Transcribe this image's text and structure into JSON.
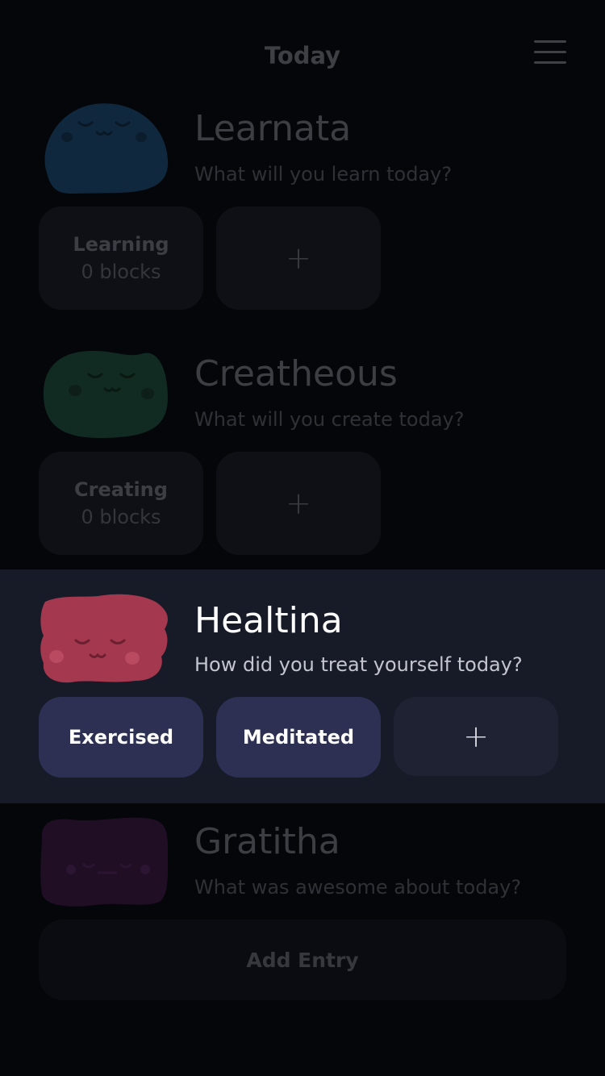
{
  "header": {
    "title": "Today",
    "menu_icon": "hamburger-menu-icon"
  },
  "sections": [
    {
      "name": "Learnata",
      "prompt": "What will you learn today?",
      "color": "#10283e",
      "chips": [
        {
          "label": "Learning",
          "count": "0 blocks"
        }
      ],
      "add_label": "+"
    },
    {
      "name": "Creatheous",
      "prompt": "What will you create today?",
      "color": "#122b22",
      "chips": [
        {
          "label": "Creating",
          "count": "0 blocks"
        }
      ],
      "add_label": "+"
    },
    {
      "name": "Healtina",
      "prompt": "How did you treat yourself today?",
      "color": "#a3384f",
      "chips": [
        {
          "label": "Exercised"
        },
        {
          "label": "Meditated"
        }
      ],
      "add_label": "+"
    },
    {
      "name": "Gratitha",
      "prompt": "What was awesome about today?",
      "color": "#200e25",
      "add_entry_label": "Add Entry"
    }
  ]
}
